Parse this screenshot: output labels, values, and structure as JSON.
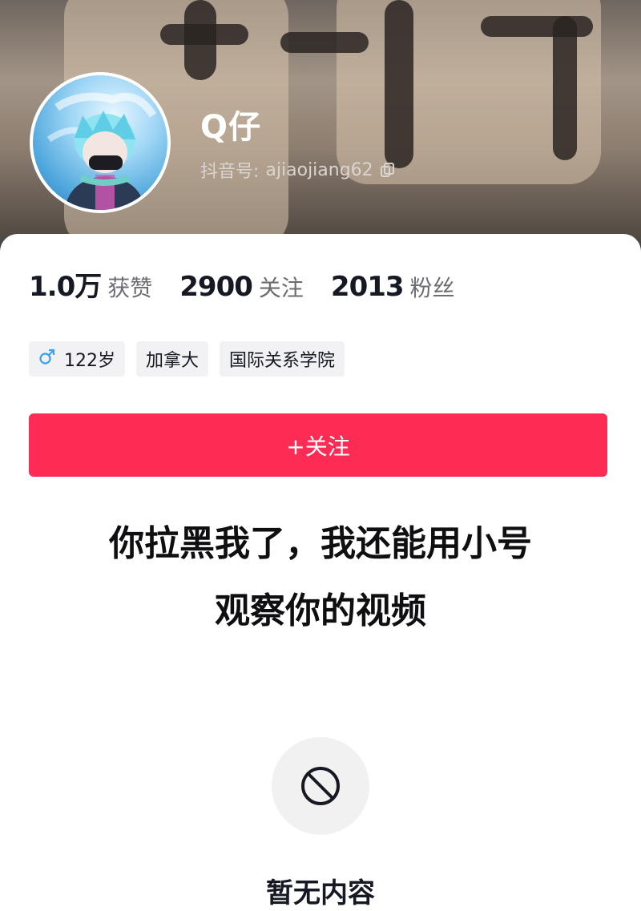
{
  "profile": {
    "username": "Q仔",
    "douyin_id_label": "抖音号:",
    "douyin_id": "ajiaojiang62"
  },
  "stats": [
    {
      "value": "1.0万",
      "label": "获赞"
    },
    {
      "value": "2900",
      "label": "关注"
    },
    {
      "value": "2013",
      "label": "粉丝"
    }
  ],
  "tags": {
    "age": "122岁",
    "location": "加拿大",
    "school": "国际关系学院"
  },
  "follow_button": "+关注",
  "caption": {
    "line1": "你拉黑我了，我还能用小号",
    "line2": "观察你的视频"
  },
  "empty_state": "暂无内容",
  "colors": {
    "accent": "#fe2c55",
    "text_primary": "#161823",
    "text_secondary": "#6b6d72",
    "gender": "#3aa1e8"
  },
  "icons": {
    "copy": "copy-icon",
    "gender": "male-icon",
    "empty": "no-entry-icon"
  }
}
